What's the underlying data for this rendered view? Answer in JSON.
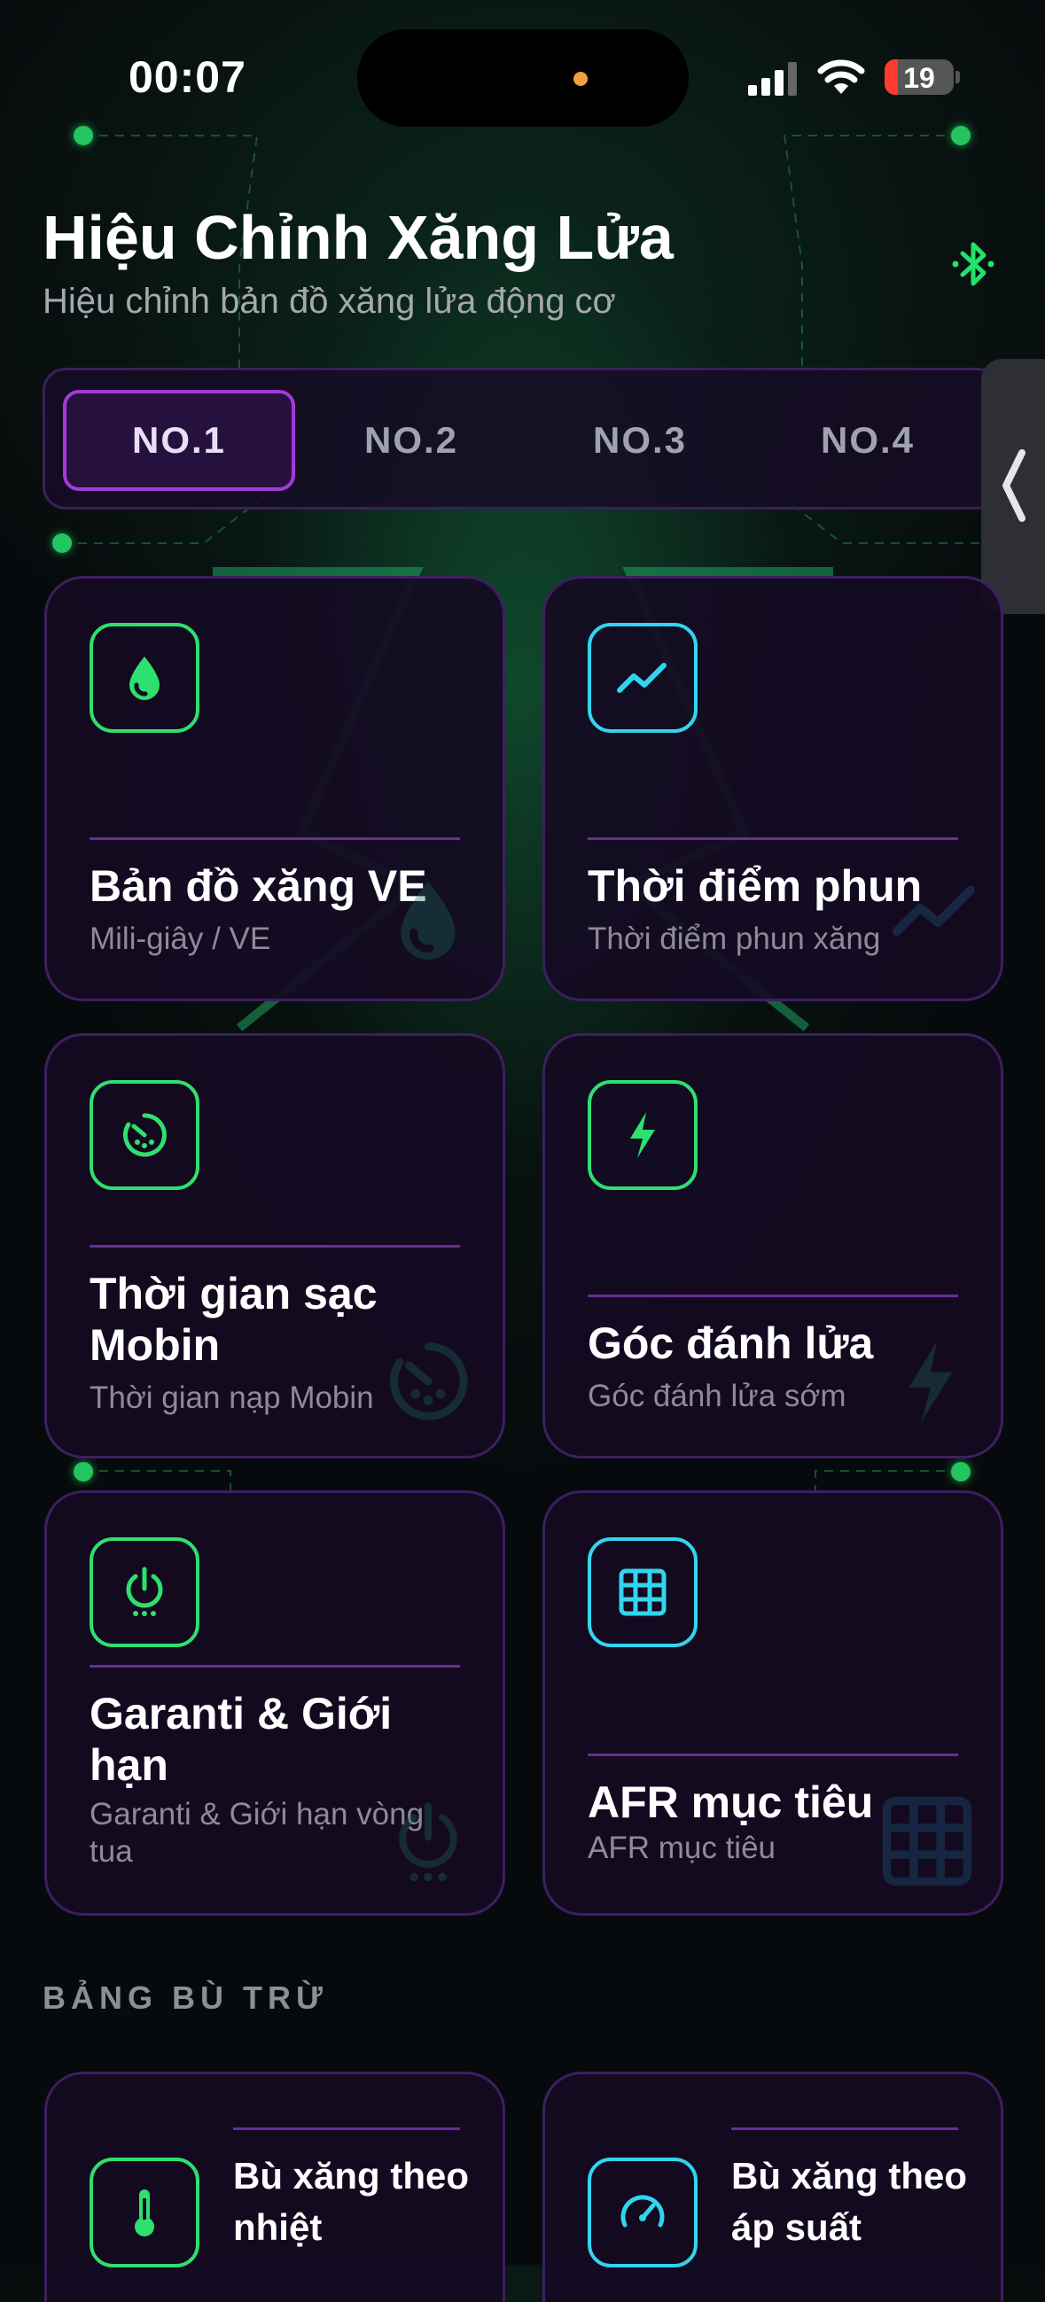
{
  "status_bar": {
    "time": "00:07",
    "battery": "19"
  },
  "header": {
    "title": "Hiệu Chỉnh Xăng Lửa",
    "subtitle": "Hiệu chỉnh bản đồ xăng lửa động cơ",
    "bluetooth_icon": "bluetooth-icon"
  },
  "tabs": [
    {
      "label": "NO.1",
      "active": true
    },
    {
      "label": "NO.2",
      "active": false
    },
    {
      "label": "NO.3",
      "active": false
    },
    {
      "label": "NO.4",
      "active": false
    }
  ],
  "cards": [
    {
      "title": "Bản đồ xăng VE",
      "subtitle": "Mili-giây / VE",
      "icon": "fuel-drop-icon",
      "accent": "#2ee06e"
    },
    {
      "title": "Thời điểm phun",
      "subtitle": "Thời điểm phun xăng",
      "icon": "trend-line-icon",
      "accent": "#32d5ee"
    },
    {
      "title": "Thời gian sạc Mobin",
      "subtitle": "Thời gian nạp Mobin",
      "icon": "timer-gauge-icon",
      "accent": "#2ee06e"
    },
    {
      "title": "Góc đánh lửa",
      "subtitle": "Góc đánh lửa sớm",
      "icon": "lightning-icon",
      "accent": "#2ee06e"
    },
    {
      "title": "Garanti & Giới hạn",
      "subtitle": "Garanti & Giới hạn vòng tua",
      "icon": "power-icon",
      "accent": "#2ee06e"
    },
    {
      "title": "AFR mục tiêu",
      "subtitle": "AFR mục tiêu",
      "icon": "grid-table-icon",
      "accent": "#32d5ee"
    }
  ],
  "compensation": {
    "section_title": "BẢNG BÙ TRỪ",
    "cards": [
      {
        "title": "Bù xăng theo nhiệt",
        "icon": "thermometer-icon",
        "accent": "#2ee06e"
      },
      {
        "title": "Bù xăng theo áp suất",
        "icon": "speedometer-icon",
        "accent": "#32d5ee"
      }
    ]
  }
}
